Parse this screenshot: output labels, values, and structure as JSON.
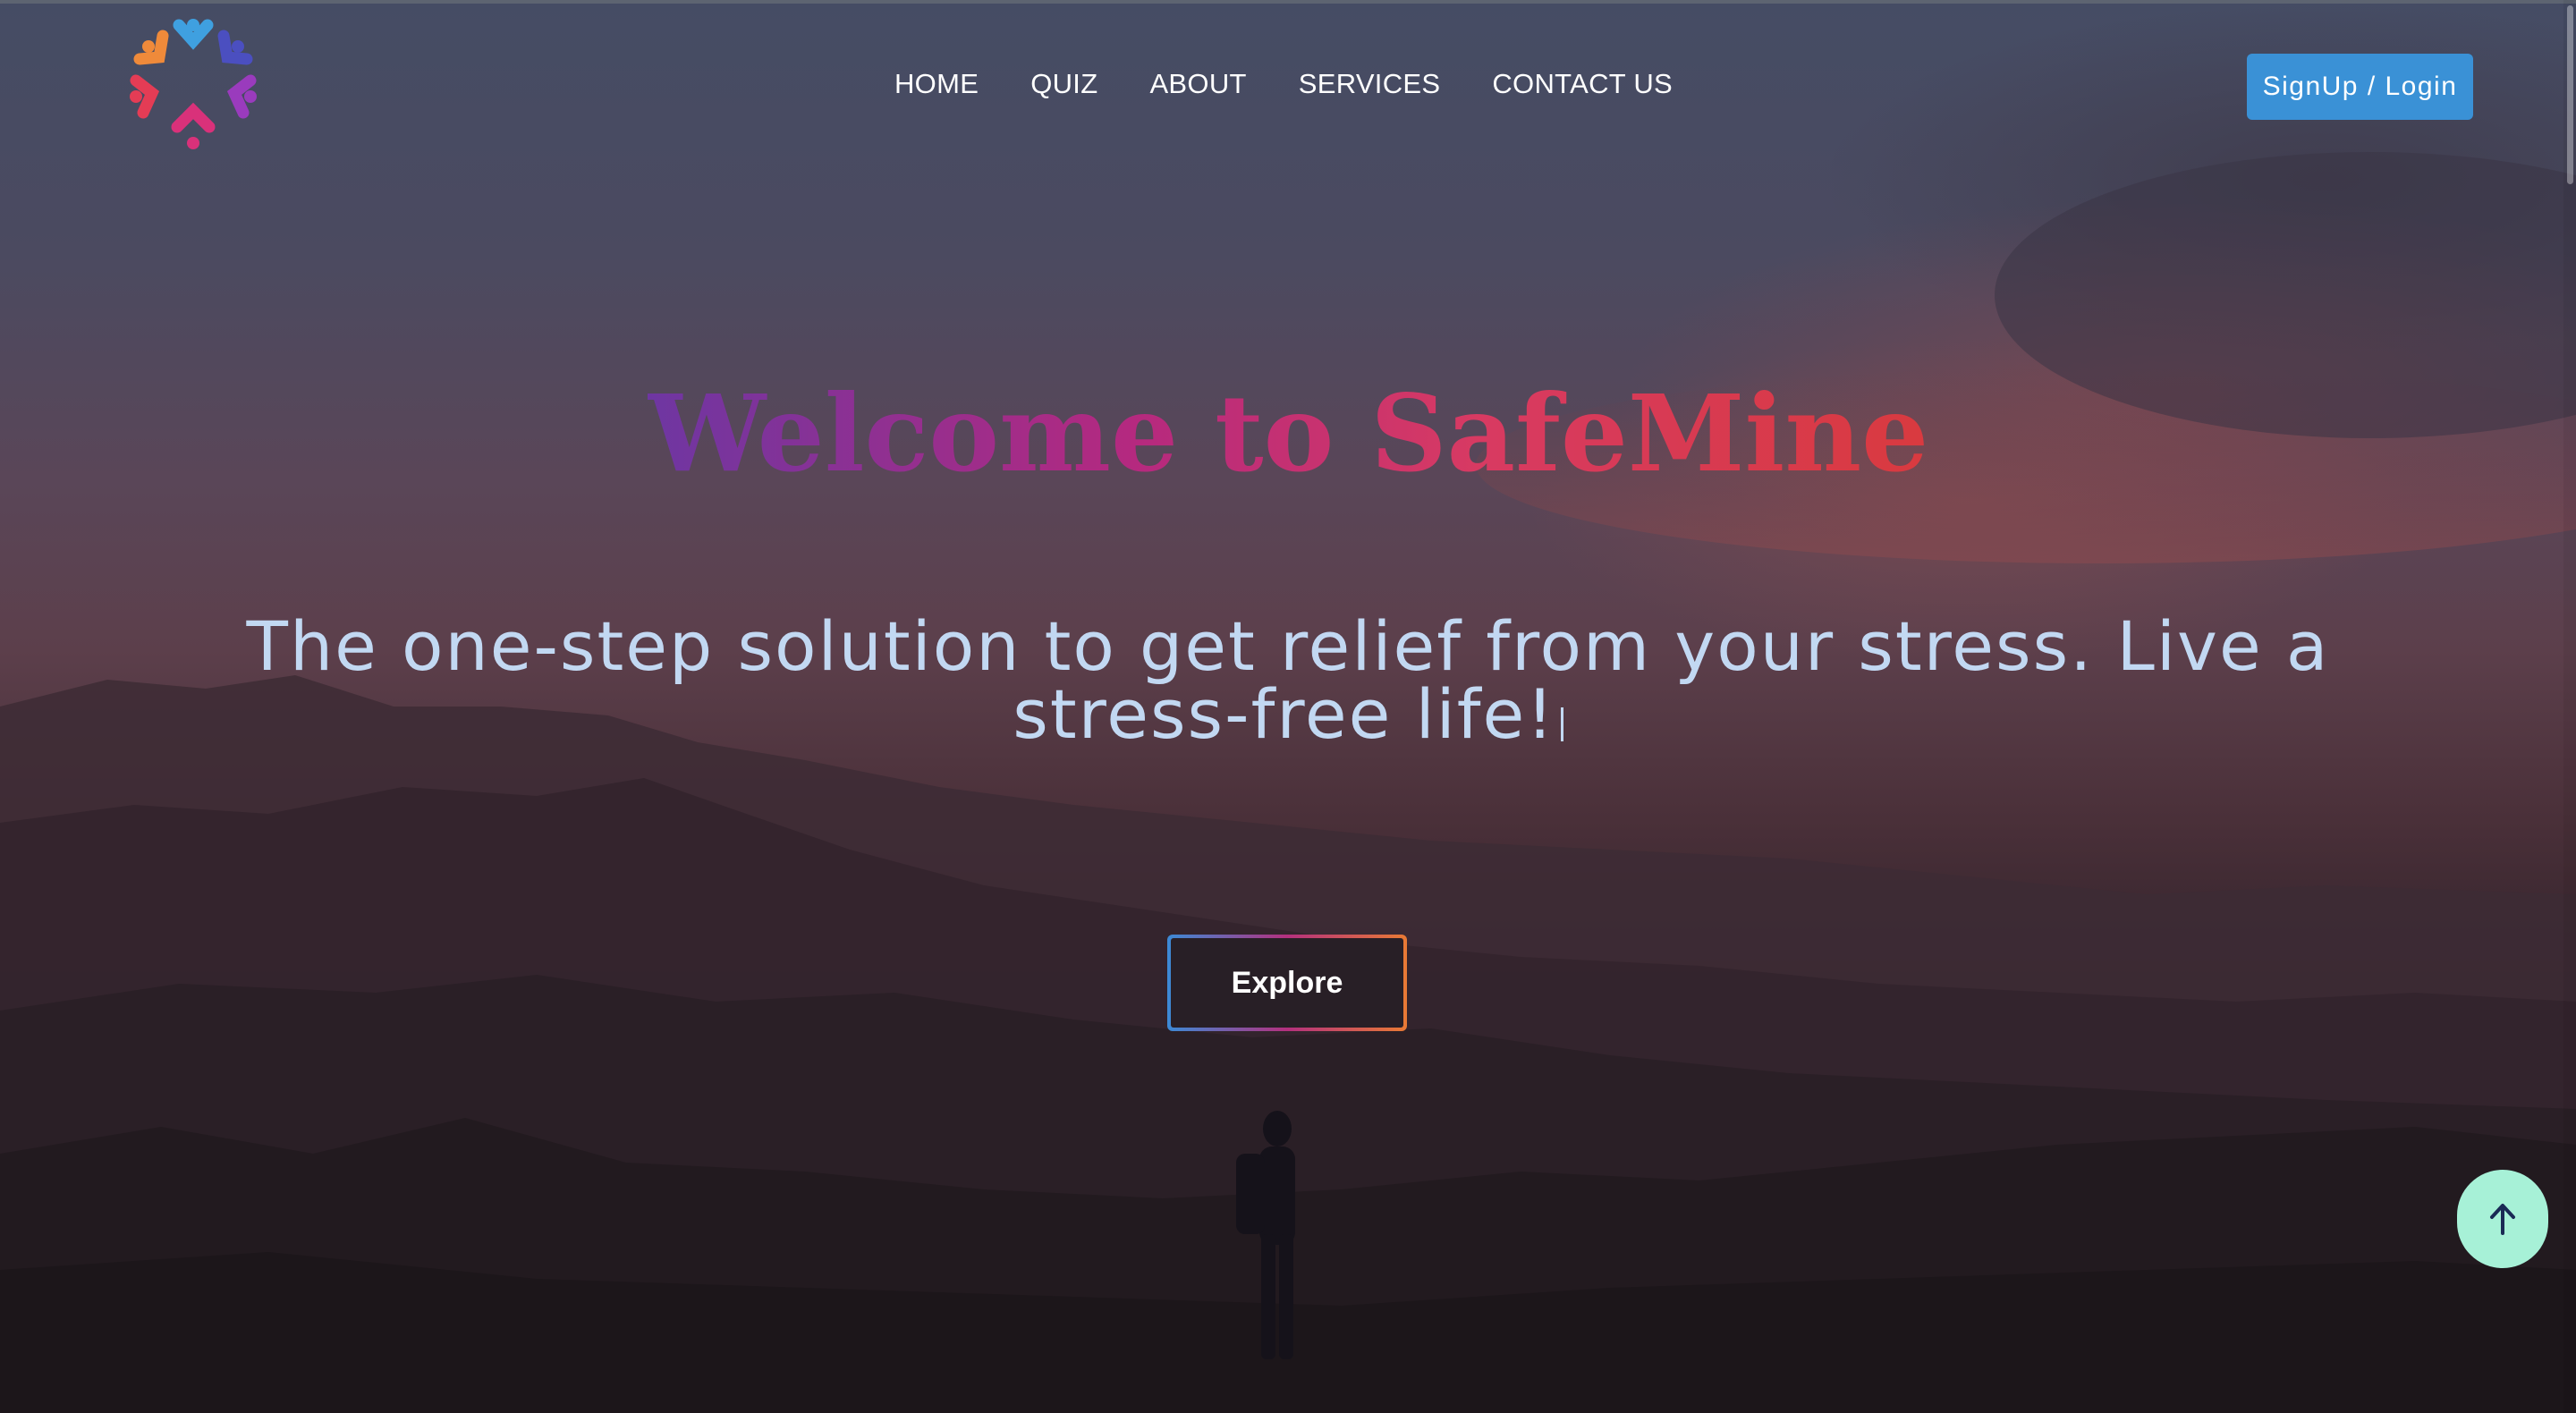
{
  "nav": {
    "logo_icon": "safemine-logo-icon",
    "links": [
      "HOME",
      "QUIZ",
      "ABOUT",
      "SERVICES",
      "CONTACT US"
    ],
    "signup_label": "SignUp / Login"
  },
  "hero": {
    "title": "Welcome to SafeMine",
    "tagline": "The one-step solution to get relief from your stress. Live a stress-free life!",
    "explore_label": "Explore"
  },
  "back_to_top": {
    "icon": "arrow-up-icon"
  },
  "colors": {
    "signup_bg": "#3a91d6",
    "back_to_top_bg": "#a7f1d7",
    "title_gradient": [
      "#6e36a2",
      "#b5297f",
      "#d83a62",
      "#d93a3f"
    ],
    "tagline": "#c2d8f2"
  }
}
